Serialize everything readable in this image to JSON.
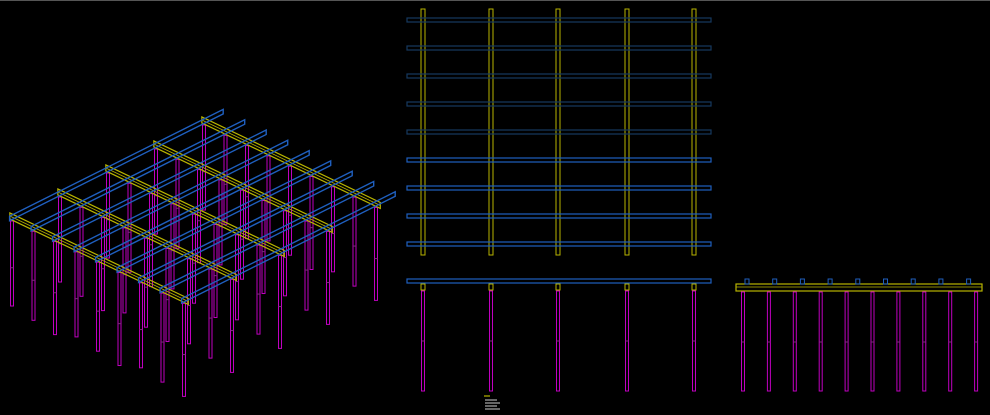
{
  "drawing": {
    "beam_count": 9,
    "joist_count": 5,
    "side_pile_count": 10,
    "colors": {
      "background": "#000000",
      "beam": "#1f5fbf",
      "beam_dim": "#16395f",
      "joist": "#b8b400",
      "pile": "#c000c0",
      "pile_dim": "#7a2a7a",
      "border": "#555555"
    }
  }
}
